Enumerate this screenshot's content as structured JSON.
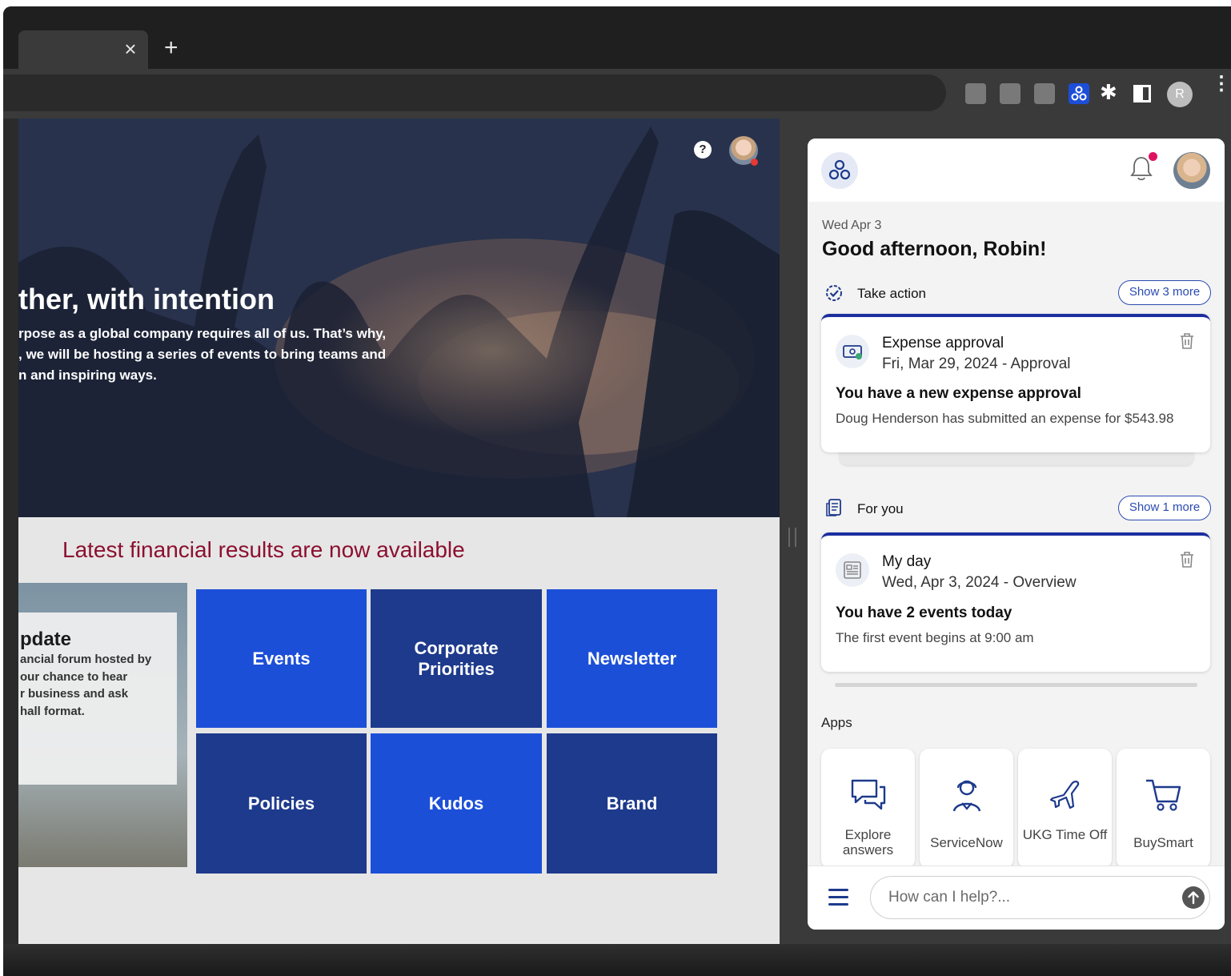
{
  "browser": {
    "tab_close": "×",
    "new_tab": "+",
    "profile_initial": "R",
    "menu": "⋮"
  },
  "site": {
    "hero": {
      "title": "ther, with intention",
      "body_lines": [
        "rpose as a global company requires all of us. That’s why,",
        ", we will be hosting a series of events to bring teams and",
        "n and inspiring ways."
      ],
      "help": "?"
    },
    "section_title": "Latest financial results are now available",
    "update": {
      "title": "pdate",
      "body_lines": [
        "ancial forum hosted by",
        "our chance to hear",
        "r business and ask",
        "hall format."
      ]
    },
    "tiles": [
      "Events",
      "Corporate Priorities",
      "Newsletter",
      "Policies",
      "Kudos",
      "Brand"
    ]
  },
  "panel": {
    "date": "Wed Apr 3",
    "greeting": "Good afternoon, Robin!",
    "take_action": {
      "label": "Take action",
      "show_more": "Show 3 more",
      "card": {
        "title": "Expense approval",
        "subtitle": "Fri, Mar 29, 2024 - Approval",
        "heading": "You have a new expense approval",
        "text": "Doug Henderson has submitted an expense for $543.98"
      }
    },
    "for_you": {
      "label": "For you",
      "show_more": "Show 1 more",
      "card": {
        "title": "My day",
        "subtitle": "Wed, Apr 3, 2024 - Overview",
        "heading": "You have 2 events today",
        "text": "The first event begins at 9:00 am"
      }
    },
    "apps_label": "Apps",
    "apps": [
      "Explore answers",
      "ServiceNow",
      "UKG Time Off",
      "BuySmart"
    ],
    "input_placeholder": "How can I help?..."
  },
  "colors": {
    "accent": "#1b2f9e",
    "tile_light": "#1c4fd8",
    "tile_dark": "#1d3a8c",
    "headline_red": "#8b1030",
    "notification": "#e0115f"
  }
}
